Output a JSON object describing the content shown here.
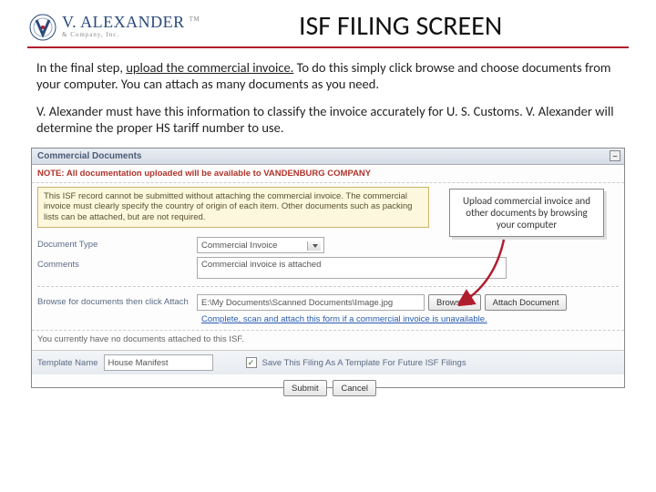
{
  "logo": {
    "main": "V. ALEXANDER",
    "sub": "& Company, Inc.",
    "tm": "TM"
  },
  "title": "ISF FILING SCREEN",
  "paragraphs": {
    "p1a": "In the final step, ",
    "p1b": "upload the commercial invoice.",
    "p1c": " To do this simply click browse and choose documents from your computer. You can attach as many documents as you need.",
    "p2": "V. Alexander must have this information to classify the invoice accurately for U. S. Customs. V. Alexander will determine the proper HS tariff number to use."
  },
  "panel": {
    "header": "Commercial Documents",
    "collapse": "–",
    "note": "NOTE: All documentation uploaded will be available to VANDENBURG COMPANY",
    "warn": "This ISF record cannot be submitted without attaching the commercial invoice. The commercial invoice must clearly specify the country of origin of each item. Other documents such as packing lists can be attached, but are not required.",
    "callout": "Upload commercial invoice and other documents by browsing your computer",
    "doc_type_label": "Document Type",
    "doc_type_value": "Commercial Invoice",
    "comments_label": "Comments",
    "comments_value": "Commercial invoice is attached",
    "browse_label": "Browse for documents then click Attach",
    "path_value": "E:\\My Documents\\Scanned Documents\\Image.jpg",
    "browse_btn": "Browse...",
    "attach_btn": "Attach Document",
    "link": "Complete, scan and attach this form if a commercial invoice is unavailable.",
    "footer_msg": "You currently have no documents attached to this ISF.",
    "template_label": "Template Name",
    "template_value": "House Manifest",
    "save_label": "Save This Filing As A Template For Future ISF Filings",
    "submit": "Submit",
    "cancel": "Cancel"
  }
}
